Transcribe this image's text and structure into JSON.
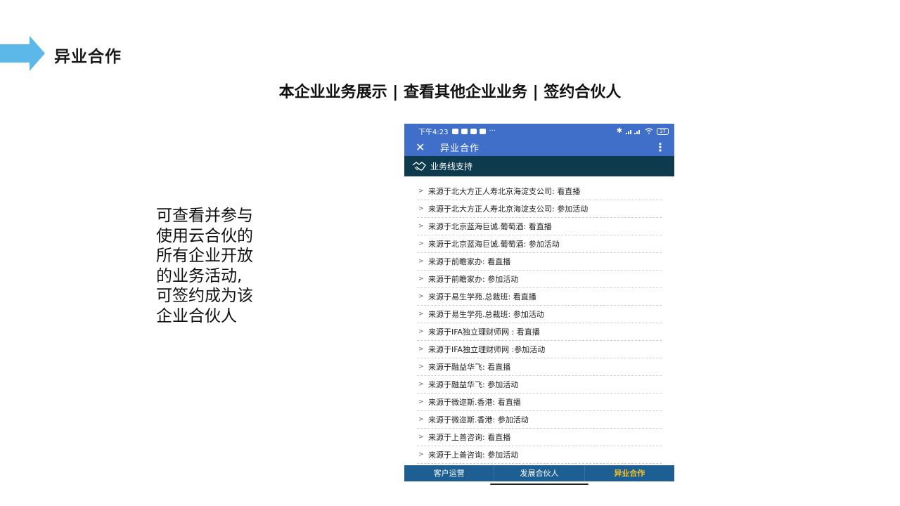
{
  "slide": {
    "title": "异业合作",
    "headline": "本企业业务展示 | 查看其他企业业务 | 签约合伙人",
    "description": "可查看并参与\n使用云合伙的\n所有企业开放\n的业务活动,\n可签约成为该\n企业合伙人",
    "accent_color": "#5cb8e8"
  },
  "phone": {
    "status_bar": {
      "time": "下午4:23",
      "dots": "···",
      "battery": "37"
    },
    "app_bar": {
      "close_icon": "close-icon",
      "title": "异业合作",
      "more_icon": "more-vertical-icon"
    },
    "section": {
      "icon": "handshake-icon",
      "title": "业务线支持"
    },
    "items": [
      "来源于北大方正人寿北京海淀支公司:  看直播",
      "来源于北大方正人寿北京海淀支公司:  参加活动",
      "来源于北京蓝海巨诚.葡萄酒:  看直播",
      "来源于北京蓝海巨诚.葡萄酒:  参加活动",
      "来源于前瞻家办:  看直播",
      "来源于前瞻家办:  参加活动",
      "来源于易生学苑.总裁班:  看直播",
      "来源于易生学苑.总裁班:  参加活动",
      "来源于IFA独立理财师网 : 看直播",
      "来源于IFA独立理财师网 :参加活动",
      "来源于融益华飞:  看直播",
      "来源于融益华飞:  参加活动",
      "来源于微迩斯.香港:  看直播",
      "来源于微迩斯.香港:  参加活动",
      "来源于上善咨询:  看直播",
      "来源于上善咨询:  参加活动"
    ],
    "bottom_nav": [
      "客户运营",
      "发展合伙人",
      "异业合作"
    ],
    "colors": {
      "app_bar": "#3f6fc8",
      "section": "#0d3a4d",
      "bottom_nav": "#1e5f93",
      "active_tab": "#f2c12e"
    }
  }
}
